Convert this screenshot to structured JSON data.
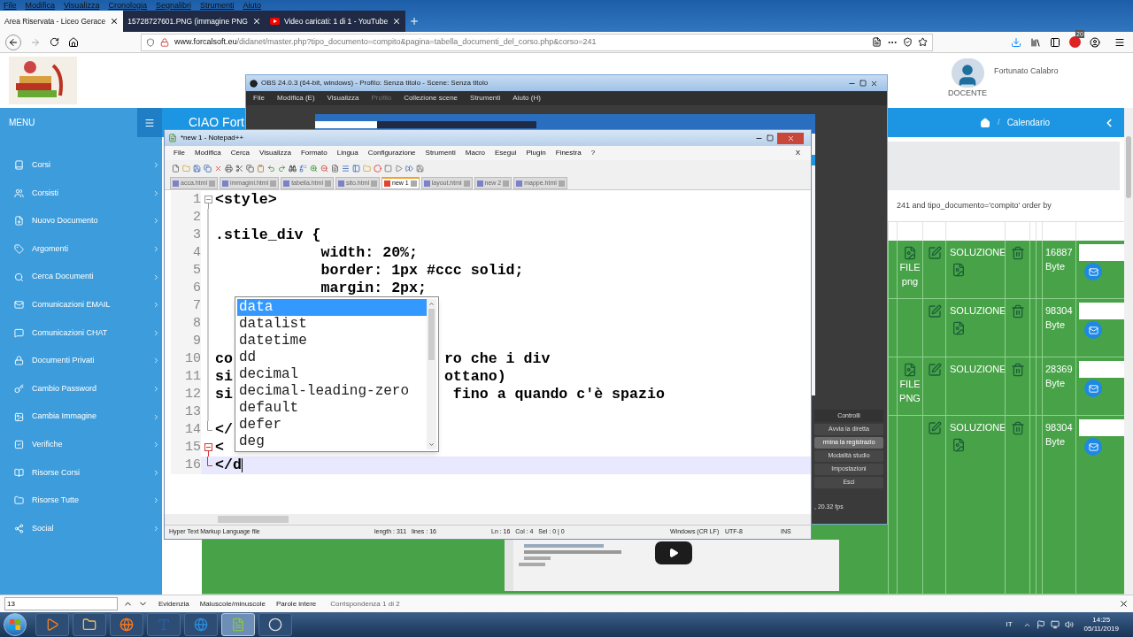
{
  "browser": {
    "menu": [
      "File",
      "Modifica",
      "Visualizza",
      "Cronologia",
      "Segnalibri",
      "Strumenti",
      "Aiuto"
    ],
    "tabs": [
      {
        "title": "Area Riservata - Liceo Gerace",
        "kind": "page",
        "selected": true
      },
      {
        "title": "15728727601.PNG (immagine PNG",
        "kind": "page",
        "selected": false
      },
      {
        "title": "Video caricati: 1 di 1 - YouTube",
        "kind": "video",
        "selected": false
      }
    ],
    "url": {
      "domain": "www.forcalsoft.eu",
      "path": "/didanet/master.php?tipo_documento=compito&pagina=tabella_documenti_del_corso.php&corso=241"
    },
    "adblock_badge": "20"
  },
  "site": {
    "menu_title": "MENU",
    "sidebar": [
      "Corsi",
      "Corsisti",
      "Nuovo Documento",
      "Argomenti",
      "Cerca Documenti",
      "Comunicazioni EMAIL",
      "Comunicazioni CHAT",
      "Documenti Privati",
      "Cambio Password",
      "Cambia Immagine",
      "Verifiche",
      "Risorse Corsi",
      "Risorse Tutte",
      "Social"
    ],
    "user": {
      "name": "Fortunato Calabro",
      "role": "DOCENTE"
    },
    "greeting": "CIAO Fort",
    "breadcrumb_separator": "/",
    "breadcrumb": "Calendario",
    "query_text": "241 and tipo_documento='compito' order by",
    "rows": [
      {
        "file_label": "FILE png",
        "solution": "SOLUZIONE",
        "has_solution_file": true,
        "size": "16887 Byte"
      },
      {
        "solution": "SOLUZIONE",
        "has_solution_file": true,
        "size": "98304 Byte"
      },
      {
        "file_label": "FILE PNG",
        "solution": "SOLUZIONE",
        "has_solution_file": false,
        "size": "28369 Byte"
      },
      {
        "solution": "SOLUZIONE",
        "has_solution_file": true,
        "size": "98304 Byte"
      }
    ]
  },
  "obs": {
    "title": "OBS 24.0.3 (64-bit, windows) - Profilo: Senza titolo - Scene: Senza titolo",
    "menu": [
      {
        "label": "File",
        "disabled": false
      },
      {
        "label": "Modifica (E)",
        "disabled": false
      },
      {
        "label": "Visualizza",
        "disabled": false
      },
      {
        "label": "Profilo",
        "disabled": true
      },
      {
        "label": "Collezione scene",
        "disabled": false
      },
      {
        "label": "Strumenti",
        "disabled": false
      },
      {
        "label": "Aiuto (H)",
        "disabled": false
      }
    ],
    "controls_title": "Controlli",
    "controls": [
      {
        "label": "Avvia la diretta",
        "selected": false
      },
      {
        "label": "rmina la registrazio",
        "selected": true
      },
      {
        "label": "Modalità studio",
        "selected": false
      },
      {
        "label": "Impostazioni",
        "selected": false
      },
      {
        "label": "Esci",
        "selected": false
      }
    ],
    "fps": ", 20.32 fps"
  },
  "notepad": {
    "title": "*new 1 - Notepad++",
    "menu": [
      "File",
      "Modifica",
      "Cerca",
      "Visualizza",
      "Formato",
      "Lingua",
      "Configurazione",
      "Strumenti",
      "Macro",
      "Esegui",
      "Plugin",
      "Finestra",
      "?"
    ],
    "close_glyph": "X",
    "tabs": [
      {
        "label": "acca.html",
        "selected": false
      },
      {
        "label": "immagini.html",
        "selected": false
      },
      {
        "label": "tabella.html",
        "selected": false
      },
      {
        "label": "sito.html",
        "selected": false
      },
      {
        "label": "new 1",
        "selected": true
      },
      {
        "label": "layout.html",
        "selected": false
      },
      {
        "label": "new 2",
        "selected": false
      },
      {
        "label": "mappe.html",
        "selected": false
      }
    ],
    "lines": [
      {
        "number": "1",
        "text": "<style>",
        "kind": "open",
        "current": false,
        "current_block": false
      },
      {
        "number": "2",
        "kind": "body",
        "current": false,
        "current_block": false
      },
      {
        "number": "3",
        "text": ".stile_div {",
        "kind": "body",
        "current": false,
        "current_block": false
      },
      {
        "number": "4",
        "text": "\t\t\twidth: 20%;",
        "kind": "body",
        "current": false,
        "current_block": false
      },
      {
        "number": "5",
        "text": "\t\t\tborder: 1px #ccc solid;",
        "kind": "body",
        "current": false,
        "current_block": false
      },
      {
        "number": "6",
        "text": "\t\t\tmargin: 2px;",
        "kind": "body",
        "current": false,
        "current_block": false
      },
      {
        "number": "7",
        "kind": "body",
        "current": false,
        "current_block": false
      },
      {
        "number": "8",
        "kind": "body",
        "current": false,
        "current_block": false
      },
      {
        "number": "9",
        "kind": "body",
        "current": false,
        "current_block": false
      },
      {
        "number": "10",
        "text": "co",
        "tail": "ro che i div",
        "kind": "body",
        "current": false,
        "current_block": false
      },
      {
        "number": "11",
        "text": "si",
        "tail": "ottano)",
        "kind": "body",
        "current": false,
        "current_block": false
      },
      {
        "number": "12",
        "text": "si",
        "tail": " fino a quando c'è spazio",
        "kind": "body",
        "current": false,
        "current_block": false
      },
      {
        "number": "13",
        "kind": "body",
        "current": false,
        "current_block": false
      },
      {
        "number": "14",
        "text": "</",
        "kind": "close",
        "current": false,
        "current_block": false
      },
      {
        "number": "15",
        "text": "<",
        "kind": "open",
        "current": false,
        "current_block": true
      },
      {
        "number": "16",
        "text": "</d",
        "kind": "close",
        "current": true,
        "current_block": true
      }
    ],
    "autocomplete": [
      {
        "label": "data",
        "selected": true
      },
      {
        "label": "datalist",
        "selected": false
      },
      {
        "label": "datetime",
        "selected": false
      },
      {
        "label": "dd",
        "selected": false
      },
      {
        "label": "decimal",
        "selected": false
      },
      {
        "label": "decimal-leading-zero",
        "selected": false
      },
      {
        "label": "default",
        "selected": false
      },
      {
        "label": "defer",
        "selected": false
      },
      {
        "label": "deg",
        "selected": false
      }
    ],
    "status": {
      "language": "Hyper Text Markup Language file",
      "length": "length : 311   lines : 16",
      "position": "Ln : 16   Col : 4   Sel : 0 | 0",
      "eol": "Windows (CR LF)",
      "encoding": "UTF-8",
      "mode": "INS"
    }
  },
  "find_bar": {
    "value": "13",
    "options": [
      "Evidenzia",
      "Maiuscole/minuscole",
      "Parole intere"
    ],
    "result": "Corrispondenza 1 di 2"
  },
  "taskbar": {
    "language": "IT",
    "time": "14:25",
    "date": "05/11/2019"
  }
}
